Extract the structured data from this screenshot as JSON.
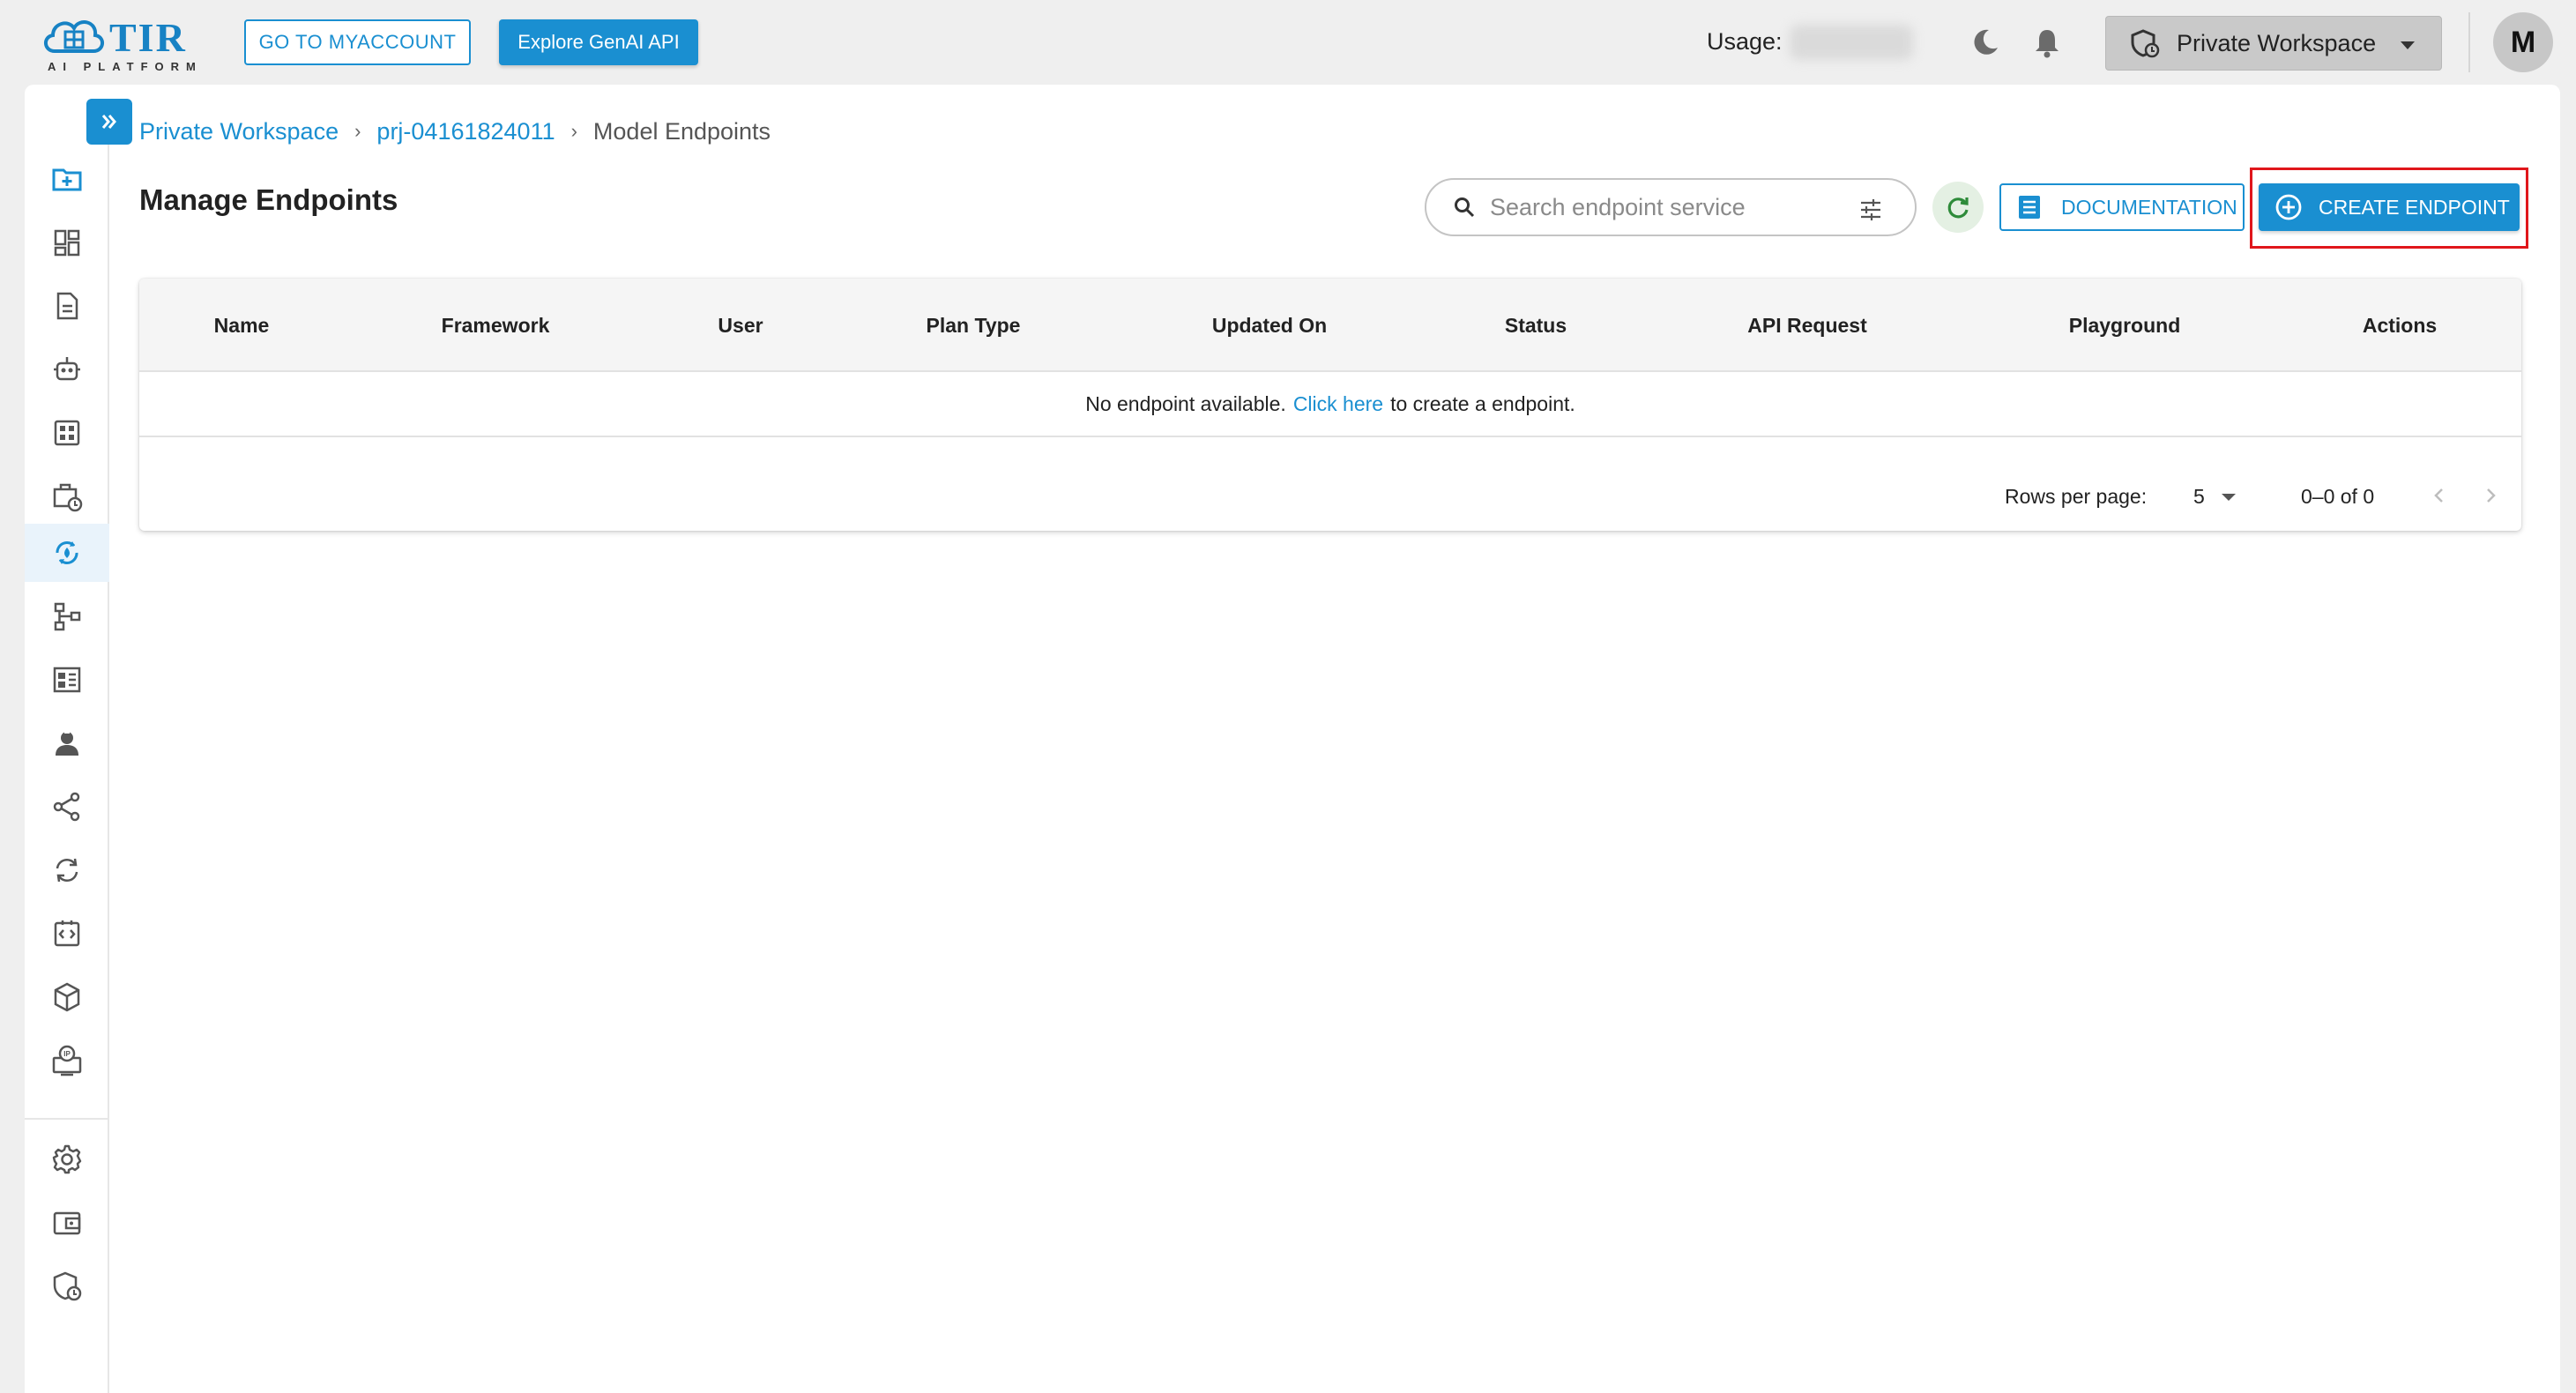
{
  "brand": {
    "name": "TIR",
    "tagline": "AI PLATFORM"
  },
  "topbar": {
    "myaccount_label": "GO TO MYACCOUNT",
    "genai_label": "Explore GenAI API",
    "usage_label": "Usage:",
    "workspace_label": "Private Workspace",
    "avatar_initial": "M"
  },
  "breadcrumb": {
    "items": [
      "Private Workspace",
      "prj-04161824011"
    ],
    "separator": "›",
    "current": "Model Endpoints"
  },
  "page": {
    "title": "Manage Endpoints",
    "search_placeholder": "Search endpoint service",
    "documentation_label": "DOCUMENTATION",
    "create_label": "CREATE ENDPOINT"
  },
  "table": {
    "columns": [
      "Name",
      "Framework",
      "User",
      "Plan Type",
      "Updated On",
      "Status",
      "API Request",
      "Playground",
      "Actions"
    ],
    "empty_prefix": "No endpoint available.",
    "empty_link": "Click here",
    "empty_suffix": "to create a endpoint.",
    "rows_per_page_label": "Rows per page:",
    "rows_per_page_value": "5",
    "range_text": "0–0 of 0"
  },
  "sidebar": {
    "items": [
      "new-project-icon",
      "dashboard-icon",
      "notebook-icon",
      "bot-icon",
      "apps-grid-icon",
      "training-jobs-icon",
      "model-endpoints-icon",
      "pipelines-icon",
      "datasets-icon",
      "user-support-icon",
      "integrations-icon",
      "sync-icon",
      "api-code-icon",
      "model-repo-icon",
      "reserved-ip-icon",
      "settings-icon",
      "billing-icon",
      "security-icon"
    ],
    "active": "model-endpoints-icon"
  },
  "colors": {
    "accent": "#1a8fd1",
    "highlight": "#e0161b",
    "background": "#efefef",
    "refresh": "#2e8b3a"
  }
}
